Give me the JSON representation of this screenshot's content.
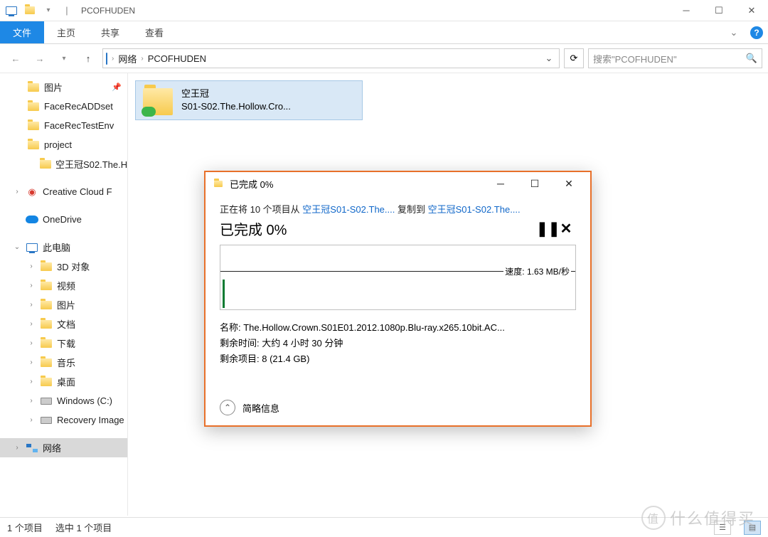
{
  "window": {
    "title": "PCOFHUDEN",
    "separator": "|"
  },
  "ribbon": {
    "file": "文件",
    "tabs": [
      "主页",
      "共享",
      "查看"
    ]
  },
  "nav": {
    "crumbs": [
      "网络",
      "PCOFHUDEN"
    ],
    "search_placeholder": "搜索\"PCOFHUDEN\""
  },
  "sidebar": {
    "quick": [
      {
        "label": "图片",
        "pinned": true
      },
      {
        "label": "FaceRecADDset"
      },
      {
        "label": "FaceRecTestEnv"
      },
      {
        "label": "project"
      },
      {
        "label": "空王冠S02.The.H"
      }
    ],
    "cloud": [
      {
        "label": "Creative Cloud F",
        "icon": "cc"
      },
      {
        "label": "OneDrive",
        "icon": "onedrive"
      }
    ],
    "thispc_label": "此电脑",
    "thispc": [
      {
        "label": "3D 对象"
      },
      {
        "label": "视频"
      },
      {
        "label": "图片"
      },
      {
        "label": "文档"
      },
      {
        "label": "下载"
      },
      {
        "label": "音乐"
      },
      {
        "label": "桌面"
      },
      {
        "label": "Windows (C:)",
        "icon": "disk"
      },
      {
        "label": "Recovery Image",
        "icon": "disk"
      }
    ],
    "network_label": "网络"
  },
  "content": {
    "item": {
      "line1": "空王冠",
      "line2": "S01-S02.The.Hollow.Cro..."
    }
  },
  "status": {
    "count": "1 个项目",
    "selected": "选中 1 个项目"
  },
  "dialog": {
    "title": "已完成 0%",
    "copying_prefix": "正在将 10 个项目从 ",
    "src_link": "空王冠S01-S02.The....",
    "copying_mid": " 复制到 ",
    "dst_link": "空王冠S01-S02.The....",
    "progress_heading": "已完成 0%",
    "speed_label": "速度: 1.63 MB/秒",
    "name_label": "名称: ",
    "name_value": "The.Hollow.Crown.S01E01.2012.1080p.Blu-ray.x265.10bit.AC...",
    "remain_time_label": "剩余时间: ",
    "remain_time_value": "大约 4 小时 30 分钟",
    "remain_items_label": "剩余项目: ",
    "remain_items_value": "8 (21.4 GB)",
    "toggle_label": "简略信息"
  },
  "watermark": "什么值得买"
}
